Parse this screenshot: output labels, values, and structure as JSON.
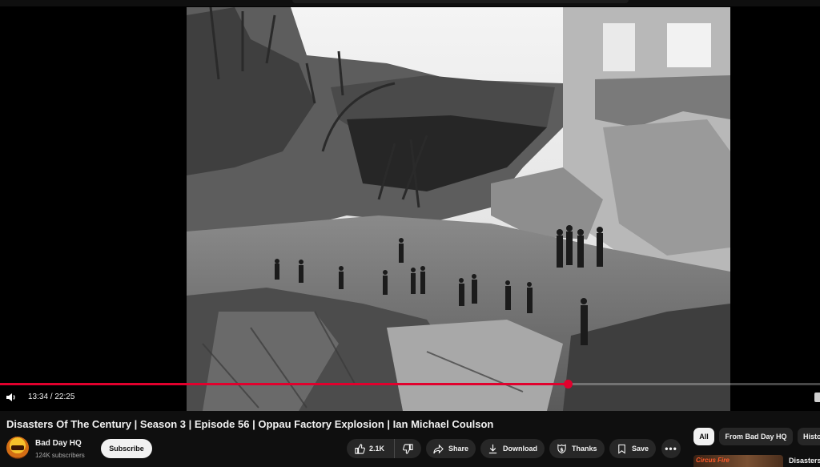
{
  "player": {
    "time_display": "13:34 / 22:25",
    "progress": 0.692
  },
  "video": {
    "title": "Disasters Of The Century | Season 3 | Episode 56 | Oppau Factory Explosion | Ian Michael Coulson"
  },
  "channel": {
    "name": "Bad Day HQ",
    "subscribers": "124K subscribers",
    "subscribe_label": "Subscribe"
  },
  "actions": {
    "likes": "2.1K",
    "share_label": "Share",
    "download_label": "Download",
    "thanks_label": "Thanks",
    "save_label": "Save",
    "more_label": "•••"
  },
  "chips": {
    "all": "All",
    "from_channel": "From Bad Day HQ",
    "history": "History"
  },
  "recommendation": {
    "thumb_text": "Circus Fire",
    "title": "Disasters"
  },
  "colors": {
    "progress": "#e1002d",
    "background": "#0f0f0f"
  }
}
